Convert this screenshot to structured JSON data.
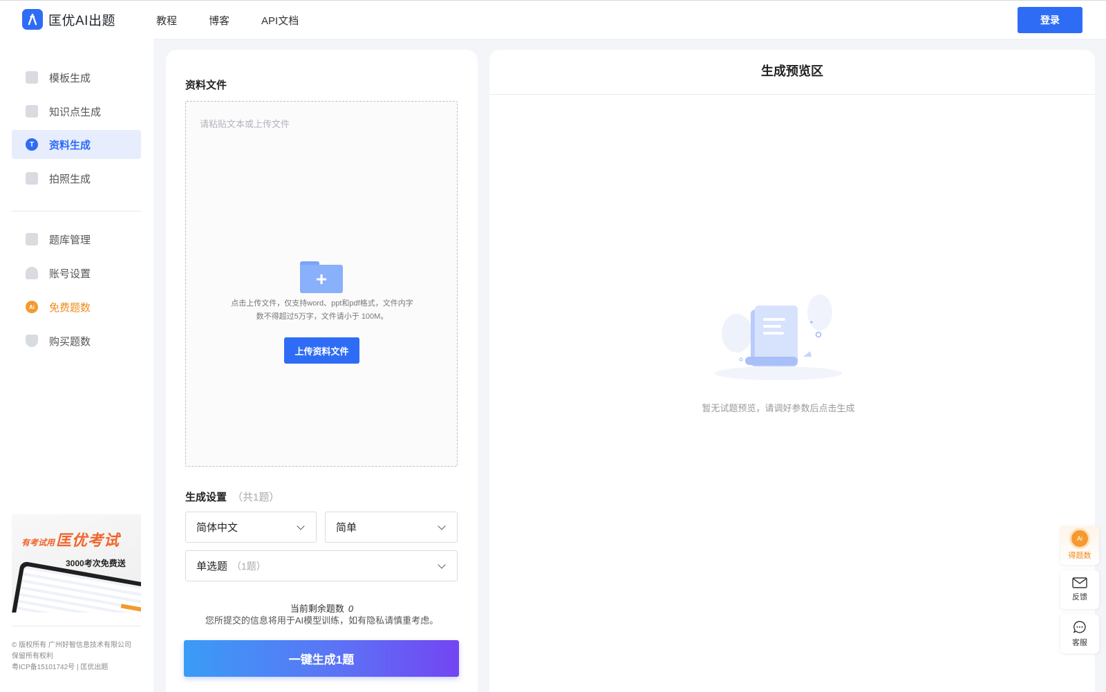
{
  "header": {
    "app_name": "匡优AI出题",
    "nav": [
      "教程",
      "博客",
      "API文档"
    ],
    "login_label": "登录"
  },
  "sidebar": {
    "items": [
      {
        "label": "模板生成",
        "icon": "template-icon"
      },
      {
        "label": "知识点生成",
        "icon": "knowledge-icon"
      },
      {
        "label": "资料生成",
        "icon": "document-icon",
        "active": true
      },
      {
        "label": "拍照生成",
        "icon": "photo-icon"
      }
    ],
    "items2": [
      {
        "label": "题库管理",
        "icon": "question-bank-icon"
      },
      {
        "label": "账号设置",
        "icon": "user-icon"
      },
      {
        "label": "免费题数",
        "icon": "ai-coin-icon"
      },
      {
        "label": "购买题数",
        "icon": "diamond-icon"
      }
    ],
    "promo": {
      "prefix": "有考试用",
      "brand": "匡优考试",
      "sub": "3000考次免费送"
    },
    "copyright": {
      "line1": "© 版权所有 广州好智信息技术有限公司",
      "line2": "保留所有权利",
      "line3": "粤ICP备15101742号 | 匡优出题"
    }
  },
  "material": {
    "title": "资料文件",
    "placeholder": "请粘贴文本或上传文件",
    "hint_line1": "点击上传文件，仅支持word、ppt和pdf格式，文件内字",
    "hint_line2": "数不得超过5万字，文件请小于 100M。",
    "upload_label": "上传资料文件"
  },
  "settings": {
    "title": "生成设置",
    "count_note": "（共1题）",
    "language": "简体中文",
    "difficulty": "简单",
    "question_type": "单选题",
    "question_type_count": "（1题）",
    "remaining_label": "当前剩余题数",
    "remaining_value": "0",
    "privacy_note": "您所提交的信息将用于AI模型训练，如有隐私请慎重考虑。",
    "generate_label": "一键生成1题"
  },
  "preview": {
    "title": "生成预览区",
    "empty_text": "暂无试题预览，请调好参数后点击生成"
  },
  "floating": {
    "get_questions": "得题数",
    "ai_badge": "Ai",
    "feedback": "反馈",
    "service": "客服"
  },
  "colors": {
    "primary": "#2f6cf6",
    "accent_orange": "#f08a1e",
    "active_bg": "#e7edfd"
  }
}
